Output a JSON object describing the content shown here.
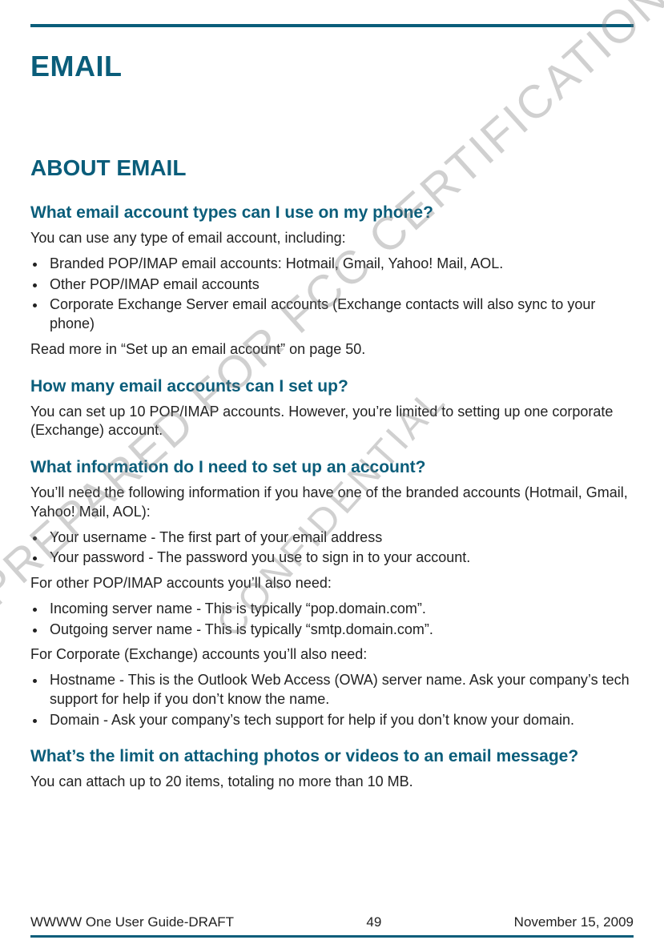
{
  "title": "EMAIL",
  "section": "ABOUT EMAIL",
  "watermark1": "PREPARED FOR FCC CERTIFICATION",
  "watermark2": "CONFIDENTIAL",
  "q1": {
    "heading": "What email account types can I use on my phone?",
    "intro": "You can use any type of email account, including:",
    "bullets": [
      "Branded POP/IMAP email accounts: Hotmail, Gmail, Yahoo! Mail, AOL.",
      "Other POP/IMAP email accounts",
      "Corporate Exchange Server email accounts (Exchange contacts will also sync to your phone)"
    ],
    "outro": "Read more in “Set up an email account” on page 50."
  },
  "q2": {
    "heading": "How many email accounts can I set up?",
    "body": "You can set up 10 POP/IMAP accounts. However, you’re limited to setting up one corporate (Exchange) account."
  },
  "q3": {
    "heading": "What information do I need to set up an account?",
    "intro": "You’ll need the following information if you have one of the branded accounts (Hotmail, Gmail, Yahoo! Mail, AOL):",
    "bullets1": [
      "Your username - The first part of your email address",
      "Your password - The password you use to sign in to your account."
    ],
    "mid1": "For other POP/IMAP accounts you’ll also need:",
    "bullets2": [
      "Incoming server name - This is typically “pop.domain.com”.",
      "Outgoing server name - This is typically “smtp.domain.com”."
    ],
    "mid2": "For Corporate (Exchange) accounts you’ll also need:",
    "bullets3": [
      "Hostname - This is the Outlook Web Access (OWA) server name. Ask your company’s tech support for help if you don’t know the name.",
      "Domain - Ask your company’s tech support for help if you don’t know your domain."
    ]
  },
  "q4": {
    "heading": "What’s the limit on attaching photos or videos to an email message?",
    "body": "You can attach up to 20 items, totaling no more than 10 MB."
  },
  "footer": {
    "left": "WWWW One User Guide-DRAFT",
    "center": "49",
    "right": "November 15, 2009"
  }
}
